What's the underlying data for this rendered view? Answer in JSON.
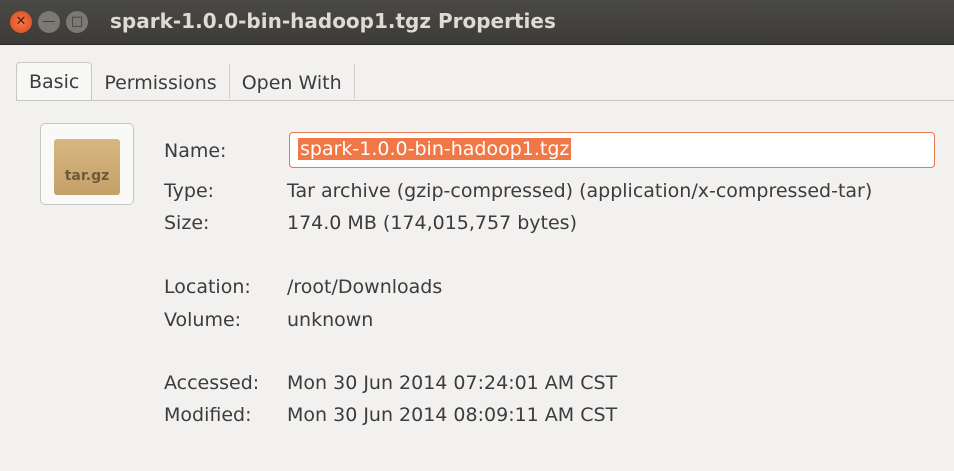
{
  "window": {
    "title": "spark-1.0.0-bin-hadoop1.tgz Properties"
  },
  "tabs": [
    "Basic",
    "Permissions",
    "Open With"
  ],
  "icon": {
    "label": "tar.gz"
  },
  "fields": {
    "name_label": "Name:",
    "name_value": "spark-1.0.0-bin-hadoop1.tgz",
    "type_label": "Type:",
    "type_value": "Tar archive (gzip-compressed) (application/x-compressed-tar)",
    "size_label": "Size:",
    "size_value": "174.0 MB (174,015,757 bytes)",
    "location_label": "Location:",
    "location_value": "/root/Downloads",
    "volume_label": "Volume:",
    "volume_value": "unknown",
    "accessed_label": "Accessed:",
    "accessed_value": "Mon 30 Jun 2014 07:24:01 AM CST",
    "modified_label": "Modified:",
    "modified_value": "Mon 30 Jun 2014 08:09:11 AM CST"
  }
}
